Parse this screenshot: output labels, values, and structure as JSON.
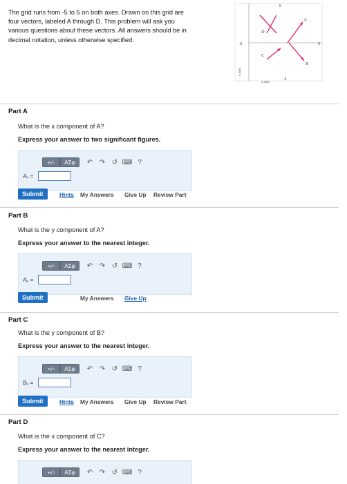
{
  "intro": {
    "line1": "The grid runs from -5 to 5 on both axes. Drawn on this grid are",
    "line2": "four vectors, labeled A through D. This problem will ask you",
    "line3": "various questions about these vectors. All answers should be in",
    "line4": "decimal notation, unless otherwise specified."
  },
  "figure": {
    "vectors": [
      {
        "label": "A",
        "color": "#e0195a"
      },
      {
        "label": "B",
        "color": "#e0195a"
      },
      {
        "label": "C",
        "color": "#e0195a"
      },
      {
        "label": "D",
        "color": "#e0195a"
      }
    ],
    "tick_top": "5",
    "tick_left": "-5",
    "tick_right": "5",
    "tick_bottom": "-5",
    "x_axis_label": "x axis",
    "y_axis_label": "y axis"
  },
  "toolbar": {
    "btn_template": "▪√▫",
    "btn_greek": "ΑΣφ",
    "undo": "↶",
    "redo": "↷",
    "reset": "↺",
    "keyboard": "⌨",
    "help": "?"
  },
  "parts": [
    {
      "title": "Part A",
      "question": "What is the x component of A?",
      "instruction": "Express your answer to two significant figures.",
      "var_label": "Aₓ =",
      "submit": "Submit",
      "links": [
        "Hints",
        "My Answers",
        "Give Up",
        "Review Part"
      ]
    },
    {
      "title": "Part B",
      "question": "What is the y component of A?",
      "instruction": "Express your answer to the nearest integer.",
      "var_label": "Aᵧ =",
      "submit": "Submit",
      "links": [
        "My Answers",
        "Give Up"
      ]
    },
    {
      "title": "Part C",
      "question": "What is the y component of B?",
      "instruction": "Express your answer to the nearest integer.",
      "var_label": "Bᵧ =",
      "submit": "Submit",
      "links": [
        "Hints",
        "My Answers",
        "Give Up",
        "Review Part"
      ]
    },
    {
      "title": "Part D",
      "question": "What is the x component of C?",
      "instruction": "Express your answer to the nearest integer."
    }
  ]
}
